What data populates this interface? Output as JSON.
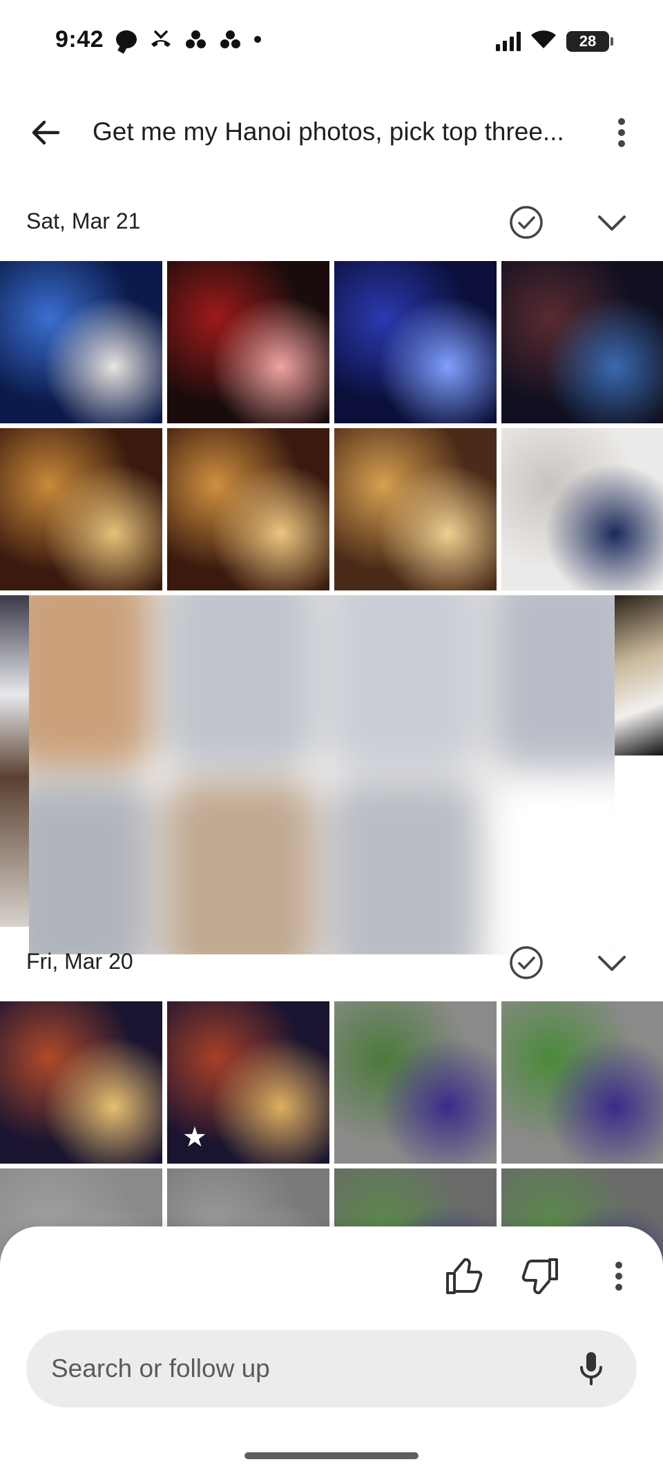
{
  "status_bar": {
    "time": "9:42",
    "battery": "28",
    "left_icons": [
      "chat-bubble-icon",
      "missed-call-icon",
      "app-dots-icon",
      "app-dots-icon",
      "dot-icon"
    ],
    "right_icons": [
      "signal-icon",
      "wifi-icon",
      "battery-icon"
    ]
  },
  "header": {
    "back_icon": "back-arrow-icon",
    "title": "Get me my Hanoi photos, pick top three...",
    "more_icon": "more-vert-icon"
  },
  "sections": [
    {
      "date": "Sat, Mar 21",
      "check_icon": "check-circle-icon",
      "chevron_icon": "chevron-down-icon",
      "photos": [
        {
          "label": "selfie-club",
          "colors": [
            "#0b1a4a",
            "#3a6fd0",
            "#e8e4df"
          ],
          "starred": false
        },
        {
          "label": "club-red-stage",
          "colors": [
            "#1a0c0c",
            "#9e1a1a",
            "#f1a3a0"
          ],
          "starred": false
        },
        {
          "label": "club-blue-lights",
          "colors": [
            "#0b0f3a",
            "#2a3ab0",
            "#7fa0ff"
          ],
          "starred": false
        },
        {
          "label": "club-crowd",
          "colors": [
            "#101020",
            "#5a2a30",
            "#3a6ab0"
          ],
          "starred": false
        },
        {
          "label": "pizza-1",
          "colors": [
            "#3a1a0e",
            "#c98a3a",
            "#e6c27a"
          ],
          "starred": false
        },
        {
          "label": "pizza-2",
          "colors": [
            "#3a1a0e",
            "#d09040",
            "#ecc680"
          ],
          "starred": false
        },
        {
          "label": "pizza-3",
          "colors": [
            "#4a2a18",
            "#d6a050",
            "#f0d090"
          ],
          "starred": false
        },
        {
          "label": "hotel-lobby",
          "colors": [
            "#eceae8",
            "#c8c4c0",
            "#1a2a5a"
          ],
          "starred": false
        }
      ]
    },
    {
      "date": "Fri, Mar 20",
      "check_icon": "check-circle-icon",
      "chevron_icon": "chevron-down-icon",
      "photos": [
        {
          "label": "beer10-bar",
          "colors": [
            "#1a1430",
            "#b04a2a",
            "#e8c070"
          ],
          "starred": false
        },
        {
          "label": "beer10-bar-2",
          "colors": [
            "#1a1430",
            "#a84028",
            "#e0b060"
          ],
          "starred": true
        },
        {
          "label": "mausoleum-family",
          "colors": [
            "#8a8a88",
            "#4a7a3a",
            "#3a2a8a"
          ],
          "starred": false
        },
        {
          "label": "mausoleum-family-2",
          "colors": [
            "#8a8a88",
            "#4a8a3a",
            "#3a2a8a"
          ],
          "starred": false
        },
        {
          "label": "evening-sky",
          "colors": [
            "#8a8a8a",
            "#a0a0a0",
            "#b0b0b0"
          ],
          "starred": false
        },
        {
          "label": "evening-sky-2",
          "colors": [
            "#7a7a7a",
            "#9a9a9a",
            "#aaaaaa"
          ],
          "starred": false
        },
        {
          "label": "square-evening",
          "colors": [
            "#6a6a6a",
            "#5a8a4a",
            "#3a3a8a"
          ],
          "starred": false
        },
        {
          "label": "square-evening-2",
          "colors": [
            "#6a6a6a",
            "#5a8a4a",
            "#3a3a8a"
          ],
          "starred": false
        }
      ]
    }
  ],
  "feedback": {
    "thumbs_up_icon": "thumbs-up-icon",
    "thumbs_down_icon": "thumbs-down-icon",
    "more_icon": "more-vert-icon"
  },
  "search": {
    "placeholder": "Search or follow up",
    "mic_icon": "mic-icon"
  }
}
